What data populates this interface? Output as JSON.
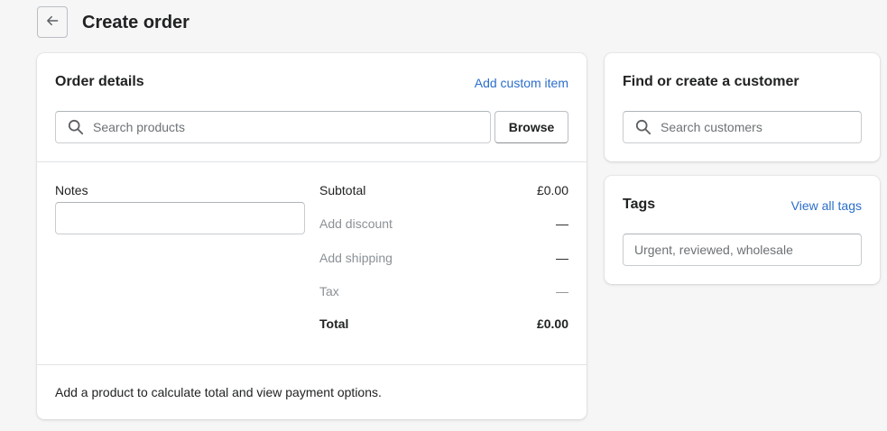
{
  "page": {
    "title": "Create order"
  },
  "order_details": {
    "heading": "Order details",
    "add_custom_item": "Add custom item",
    "search_placeholder": "Search products",
    "browse_label": "Browse",
    "notes_label": "Notes",
    "notes_value": "",
    "summary": {
      "subtotal_label": "Subtotal",
      "subtotal_value": "£0.00",
      "discount_label": "Add discount",
      "discount_value": "—",
      "shipping_label": "Add shipping",
      "shipping_value": "—",
      "tax_label": "Tax",
      "tax_value": "—",
      "total_label": "Total",
      "total_value": "£0.00"
    },
    "footer_text": "Add a product to calculate total and view payment options."
  },
  "customer": {
    "heading": "Find or create a customer",
    "search_placeholder": "Search customers"
  },
  "tags": {
    "heading": "Tags",
    "view_all": "View all tags",
    "input_placeholder": "Urgent, reviewed, wholesale"
  },
  "icons": {
    "back": "arrow-left-icon",
    "search": "search-icon"
  },
  "colors": {
    "background": "#f6f6f7",
    "link": "#2c6ecb",
    "text": "#202223",
    "muted": "#8c9196"
  }
}
